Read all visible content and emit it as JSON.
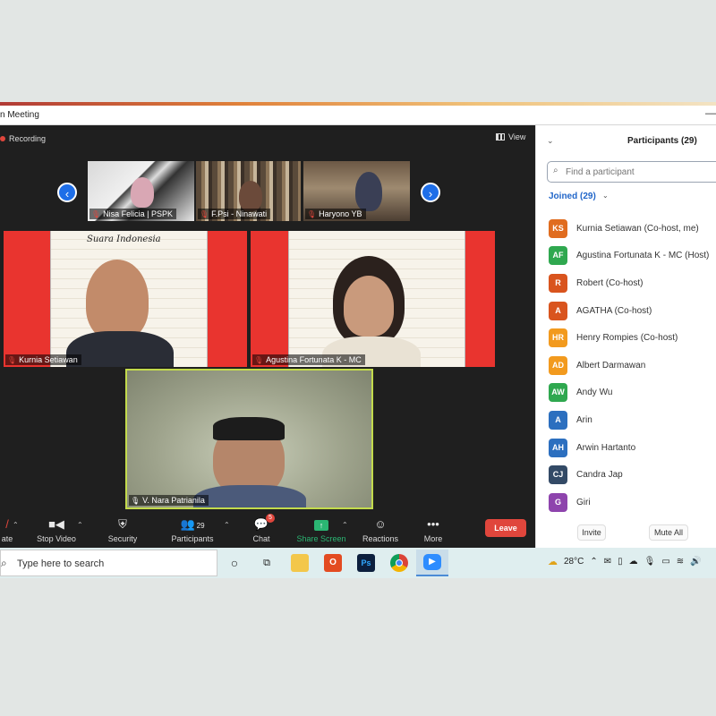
{
  "window": {
    "title": "n Meeting"
  },
  "meeting": {
    "recording_label": "Recording",
    "view_label": "View",
    "thumbnails": [
      {
        "name": "Nisa Felicia | PSPK"
      },
      {
        "name": "F.Psi - Ninawati"
      },
      {
        "name": "Haryono YB"
      }
    ],
    "tiles": [
      {
        "name": "Kurnia Setiawan"
      },
      {
        "name": "Agustina Fortunata K - MC"
      },
      {
        "name": "V. Nara Patrianila"
      }
    ],
    "poster_heading": "Suara Indonesia"
  },
  "toolbar": {
    "items": [
      {
        "label": "ate",
        "icon": "mic-off-icon"
      },
      {
        "label": "Stop Video",
        "icon": "video-icon"
      },
      {
        "label": "Security",
        "icon": "shield-icon"
      },
      {
        "label": "Participants",
        "icon": "people-icon",
        "count": "29"
      },
      {
        "label": "Chat",
        "icon": "chat-icon",
        "badge": "5"
      },
      {
        "label": "Share Screen",
        "icon": "share-icon",
        "color": "#2bb673"
      },
      {
        "label": "Reactions",
        "icon": "smiley-icon"
      },
      {
        "label": "More",
        "icon": "more-icon"
      }
    ],
    "leave_label": "Leave",
    "leave_color": "#e0463c"
  },
  "participants_panel": {
    "title": "Participants (29)",
    "search_placeholder": "Find a participant",
    "joined_label": "Joined (29)",
    "invite_label": "Invite",
    "mute_all_label": "Mute All",
    "participants": [
      {
        "initials": "KS",
        "name": "Kurnia Setiawan (Co-host, me)",
        "color": "#e06c1f"
      },
      {
        "initials": "AF",
        "name": "Agustina Fortunata K - MC (Host)",
        "color": "#2fa84f"
      },
      {
        "initials": "R",
        "name": "Robert (Co-host)",
        "color": "#d9541e"
      },
      {
        "initials": "A",
        "name": "AGATHA (Co-host)",
        "color": "#d9541e"
      },
      {
        "initials": "HR",
        "name": "Henry Rompies (Co-host)",
        "color": "#f29a1e"
      },
      {
        "initials": "AD",
        "name": "Albert Darmawan",
        "color": "#f29a1e"
      },
      {
        "initials": "AW",
        "name": "Andy Wu",
        "color": "#2fa84f"
      },
      {
        "initials": "A",
        "name": "Arin",
        "color": "#2c6fbf"
      },
      {
        "initials": "AH",
        "name": "Arwin Hartanto",
        "color": "#2c6fbf"
      },
      {
        "initials": "CJ",
        "name": "Candra Jap",
        "color": "#334a66"
      },
      {
        "initials": "G",
        "name": "Giri",
        "color": "#8e44ad"
      }
    ]
  },
  "taskbar": {
    "search_text": "Type here to search",
    "temperature": "28°C",
    "office_glyph": "O",
    "ps_glyph": "Ps"
  }
}
